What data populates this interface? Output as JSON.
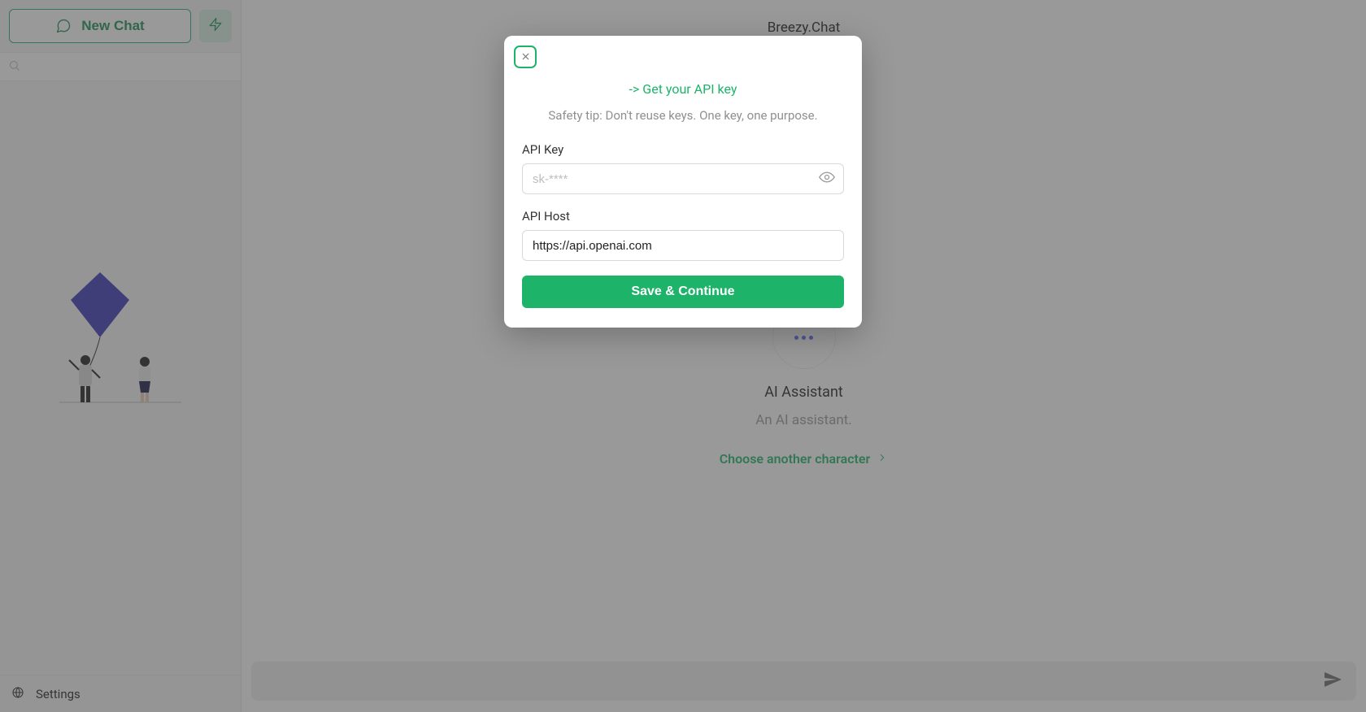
{
  "sidebar": {
    "new_chat_label": "New Chat",
    "settings_label": "Settings"
  },
  "header": {
    "app_title": "Breezy.Chat"
  },
  "assistant": {
    "title": "AI Assistant",
    "desc": "An AI assistant.",
    "choose_label": "Choose another character"
  },
  "composer": {
    "placeholder": ""
  },
  "modal": {
    "get_key_link": "-> Get your API key",
    "safety_tip": "Safety tip: Don't reuse keys. One key, one purpose.",
    "api_key_label": "API Key",
    "api_key_placeholder": "sk-****",
    "api_key_value": "",
    "api_host_label": "API Host",
    "api_host_value": "https://api.openai.com",
    "save_label": "Save & Continue"
  }
}
